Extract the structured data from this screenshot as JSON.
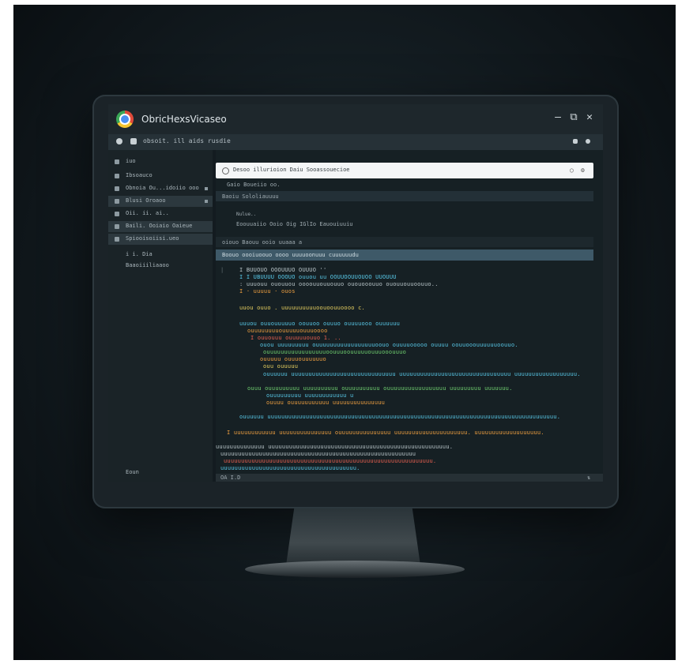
{
  "window": {
    "title": "ObricHexsVicaseo"
  },
  "window_controls": {
    "minimize": "—",
    "maximize": "⧉",
    "close": "✕"
  },
  "toolbar": {
    "menu_text": "obsoit. ill   aids   rusdie"
  },
  "sidebar": {
    "header": "iuo",
    "items": [
      {
        "label": "Ibsoauco",
        "active": false
      },
      {
        "label": "Obnoia  Ou...idoiio ooo",
        "active": false
      },
      {
        "label": "Blusi Oroaoo",
        "active": true
      },
      {
        "label": "Oii. ii. ai..",
        "active": false
      },
      {
        "label": "Baili. Ooiaio  Oaieue",
        "active": true
      },
      {
        "label": "Spiooisoiisi.ueo",
        "active": true
      },
      {
        "label": "i  i. Dia",
        "active": false
      },
      {
        "label": "Baaoiiiliaaoo",
        "active": false
      }
    ],
    "footer": "Eoun"
  },
  "address_bar": {
    "url": "Desoo  illurioion  Daiu Sooassouecioe"
  },
  "main": {
    "breadcrumb": "Gaio  Boueiio oo.",
    "field_bar": "Baoiu  Sololiauuuu",
    "meta_label": "Nulue..",
    "meta_line": "Eoouuaiio   Ooio Oig   IGlIo   Eauouiuuiu",
    "tabs_line": "oiouo   Baouu   ooio   uuaaa   a",
    "highlight_line": "Boouo  oooiuoouo  oooo  uuuuoonuuu  cuuuuuudu"
  },
  "code_lines": [
    {
      "t": "I BUUOUO  OOOUUUO  OUUUO       ''",
      "c": "c-w"
    },
    {
      "t": "I  I  UBUUUU  OOOUO ouuou  uu OOUUOOUUOUOO  UUOUUU",
      "c": "c-c"
    },
    {
      "t": "  : uuuouu ououuou  oooouuouuouuo ououooouuo ououuouuoouuo..",
      "c": "c-w"
    },
    {
      "t": "I  · uuuuu · ouos",
      "c": "c-o"
    },
    {
      "t": "uuou  ouuo .  uuuuuuuuuuoouoouuoooo c.",
      "c": "c-y"
    },
    {
      "t": "uuuou   ouuouuuuuo  oouuoo ouuuo  ouuuuooo  ouuuuuu",
      "c": "c-c"
    },
    {
      "t": "ouuuuuuuuouuuuuouuuoooo",
      "c": "c-o"
    },
    {
      "t": "I ouuouuu  ouuuuuouuo 1. ..",
      "c": "c-r"
    },
    {
      "t": "ouou   uuuuuuuuu  ouuuuuuuuuuuuuuuuuoouo  ouuuuooooo  ouuuu  oouuooouuuuuuoouuo.",
      "c": "c-c"
    },
    {
      "t": "ouuuuuuuuuuuuuuuuuoouuuoouuuuuouuuooouuuo",
      "c": "c-g"
    },
    {
      "t": "ouuuuu  ouuuouuuuuuo",
      "c": "c-o"
    },
    {
      "t": "ouu  ouuuuu",
      "c": "c-y"
    },
    {
      "t": "ouuuuuu  uuuuuuuuuuuuuuuuuuuuuuuuuuuuuu  uuuuuuuuuuuuuuuuuuuuuuuuuuuuuuuu  uuuuuuuuuuuuuuuuuu.",
      "c": "c-c"
    },
    {
      "t": "ouuu  ouuuuuuuuu  uuuuuuuuuu  ouuuuuuuuuu  ouuuuuuuuuuuuuuuuu  uuuuuuuuu  uuuuuuu.",
      "c": "c-g"
    },
    {
      "t": "ouuuuuuuuu  uuuuuuuuuuuu  u",
      "c": "c-c"
    },
    {
      "t": "ouuuu  ouuuuuuuuuuu  uuuuuuuuuuuuuuu",
      "c": "c-o"
    },
    {
      "t": "ouuuuuu  uuuuuuuuuuuuuuuuuuuuuuuuuuuuuuuuuuuuuuuuuuuuuuuuuuuuuuuuuuuuuuuuuuuuuuuuuuuuuuuuuuu.",
      "c": "c-c"
    },
    {
      "t": "I uuuuuuuuuuuu  uuuuuuuuuuuuuuu  ouuuuuuuuuuuuuuu  uuuuuuuuuuuuuuuuuuuuu.  uuuuuuuuuuuuuuuuuuu.",
      "c": "c-o"
    },
    {
      "t": "uuuuuuuuuuuuuu  uuuuuuuuuuuuuuuuuuuuuuuuuuuuuuuuuuuuuuuuuuuuuuuuuuuu.",
      "c": "c-w"
    },
    {
      "t": "uuuuuuuuuuuuuuuuuuuuuuuuuuuuuuuuuuuuuuuuuuuuuuuuuuuuuuuu",
      "c": "c-w"
    },
    {
      "t": "uuuuuuuuuuuuuuuuuuuuuuuuuuuuuuuuuuuuuuuuuuuuuuuuuuuuuuuuuuuu.",
      "c": "c-r"
    },
    {
      "t": "uuuuuuuuuuuuuuuuuuuuuuuuuuuuuuuuuuuuuuu.",
      "c": "c-c"
    }
  ],
  "status_bar": {
    "left": "OA I.D",
    "right": "⇅"
  },
  "colors": {
    "screen_bg": "#131b20",
    "accent_highlight": "#3e5968",
    "code_orange": "#f0a040",
    "code_cyan": "#58c8e8",
    "code_green": "#70d070"
  },
  "icons": [
    "app-logo-icon",
    "minimize-icon",
    "maximize-icon",
    "close-icon",
    "refresh-icon",
    "settings-icon"
  ]
}
